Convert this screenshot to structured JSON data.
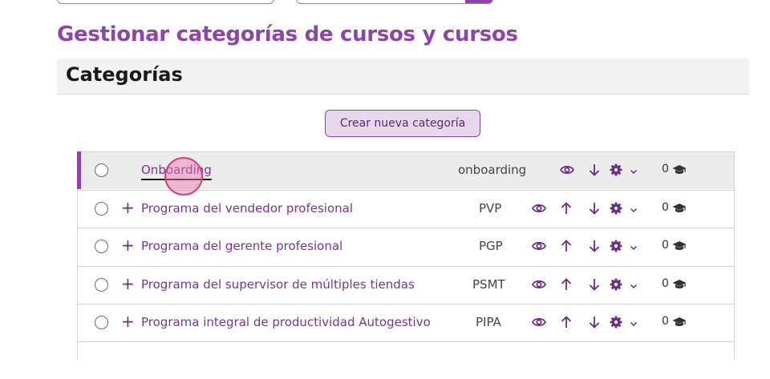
{
  "page_title": "Gestionar categorías de cursos y cursos",
  "section_title": "Categorías",
  "create_button_label": "Crear nueva categoría",
  "accent_color": "#8e44ad",
  "categories": [
    {
      "name": "Onboarding",
      "idnumber": "onboarding",
      "count": "0",
      "expandable": false,
      "active": true
    },
    {
      "name": "Programa del vendedor profesional",
      "idnumber": "PVP",
      "count": "0",
      "expandable": true,
      "active": false
    },
    {
      "name": "Programa del gerente profesional",
      "idnumber": "PGP",
      "count": "0",
      "expandable": true,
      "active": false
    },
    {
      "name": "Programa del supervisor de múltiples tiendas",
      "idnumber": "PSMT",
      "count": "0",
      "expandable": true,
      "active": false
    },
    {
      "name": "Programa integral de productividad Autogestivo",
      "idnumber": "PIPA",
      "count": "0",
      "expandable": true,
      "active": false
    }
  ],
  "row_icons": [
    "eye-icon",
    "arrow-up-icon",
    "arrow-down-icon",
    "gear-icon",
    "chevron-down-icon",
    "graduation-cap-icon"
  ]
}
